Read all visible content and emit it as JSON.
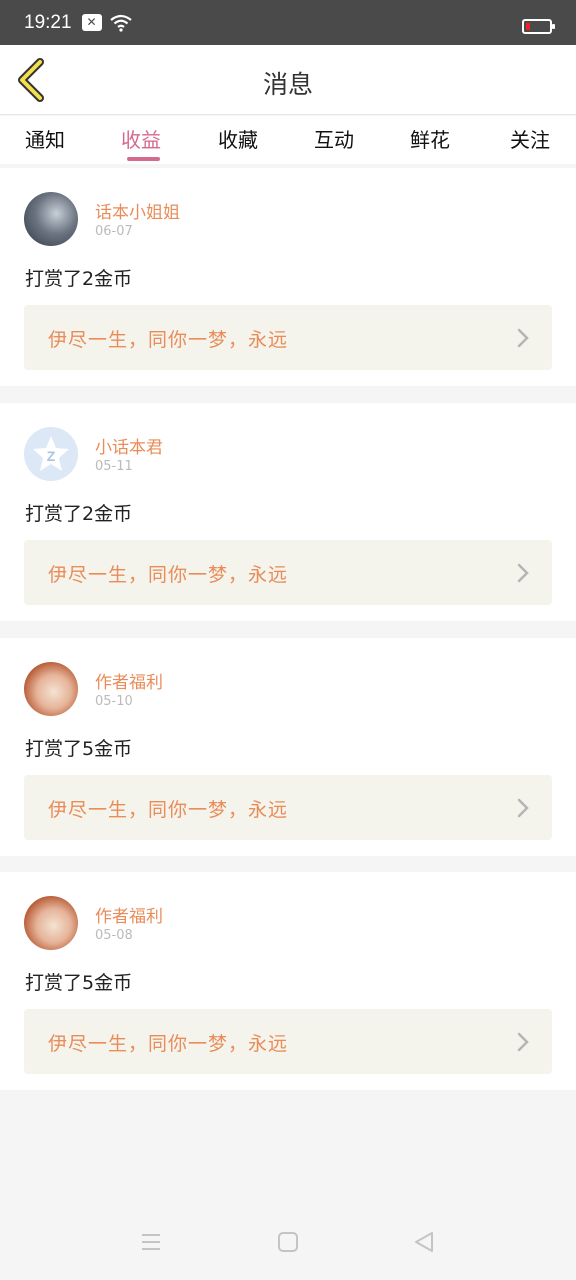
{
  "status": {
    "time": "19:21"
  },
  "header": {
    "title": "消息"
  },
  "tabs": [
    {
      "label": "通知"
    },
    {
      "label": "收益"
    },
    {
      "label": "收藏"
    },
    {
      "label": "互动"
    },
    {
      "label": "鲜花"
    },
    {
      "label": "关注"
    }
  ],
  "active_tab": "收益",
  "messages": [
    {
      "name": "话本小姐姐",
      "date": "06-07",
      "action": "打赏了2金币",
      "book": "伊尽一生，同你一梦，永远"
    },
    {
      "name": "小话本君",
      "date": "05-11",
      "action": "打赏了2金币",
      "book": "伊尽一生，同你一梦，永远"
    },
    {
      "name": "作者福利",
      "date": "05-10",
      "action": "打赏了5金币",
      "book": "伊尽一生，同你一梦，永远"
    },
    {
      "name": "作者福利",
      "date": "05-08",
      "action": "打赏了5金币",
      "book": "伊尽一生，同你一梦，永远"
    }
  ],
  "colors": {
    "accent": "#d46a8e",
    "orange": "#e98c59",
    "status_bar": "#4a4a4a"
  },
  "icons": [
    "back-chevron-icon",
    "chevron-right-icon",
    "menu-icon",
    "home-icon",
    "back-triangle-icon"
  ]
}
